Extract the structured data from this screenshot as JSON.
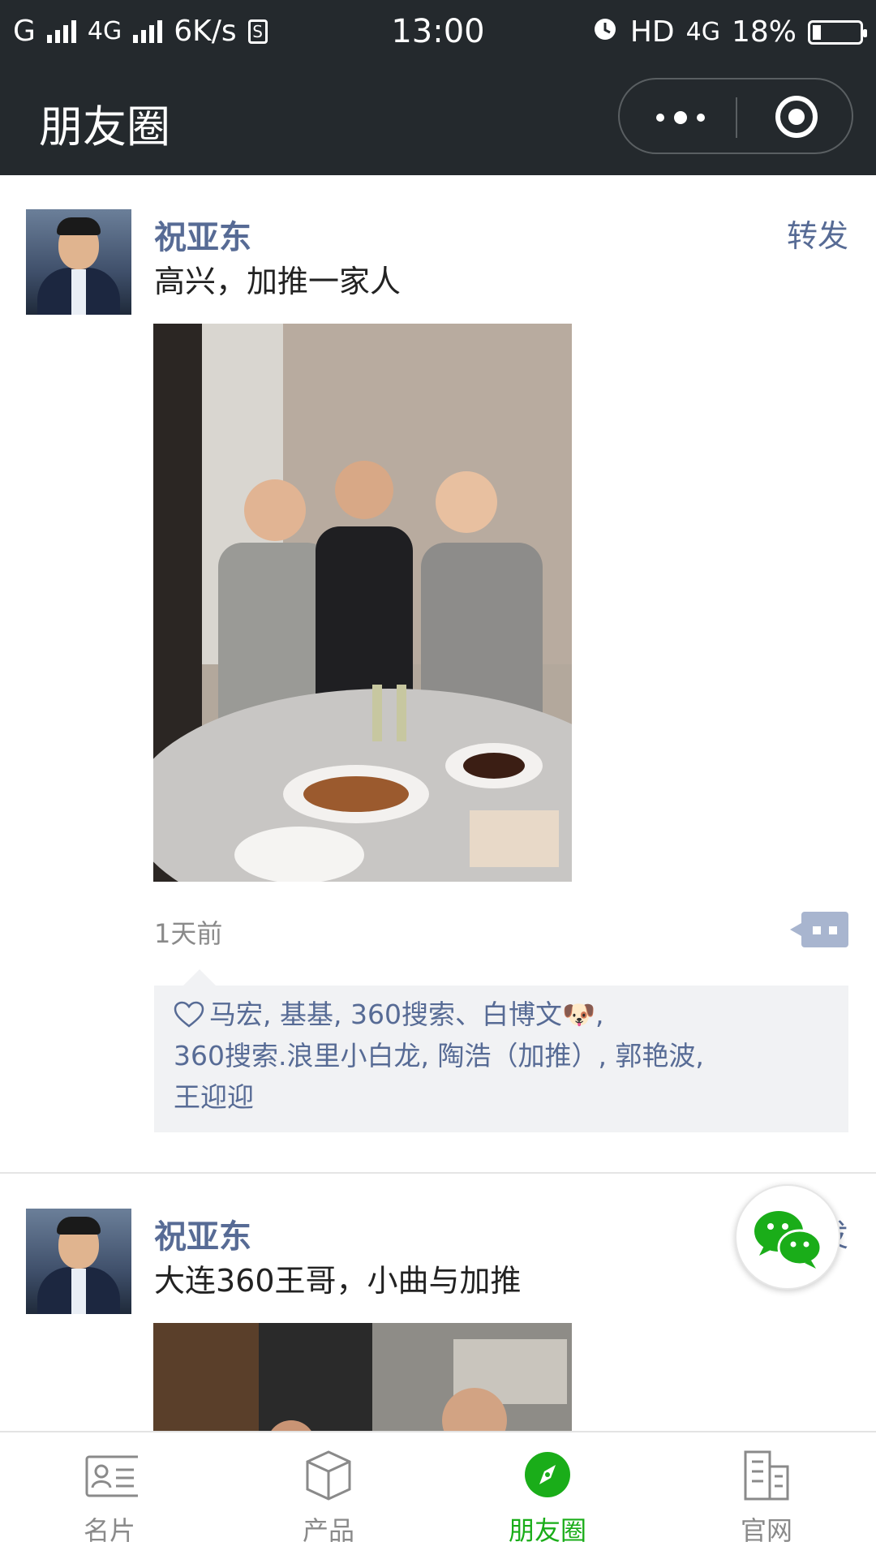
{
  "status_bar": {
    "carrier1": "G",
    "carrier2": "4G",
    "speed": "6K/s",
    "time": "13:00",
    "hd": "HD",
    "network": "4G",
    "battery": "18%"
  },
  "nav": {
    "title": "朋友圈"
  },
  "posts": [
    {
      "author": "祝亚东",
      "forward_label": "转发",
      "text": "高兴，加推一家人",
      "time": "1天前",
      "likes_line1": "马宏, 基基, 360搜索、白博文🐶,",
      "likes_line2": "360搜索.浪里小白龙, 陶浩（加推）, 郭艳波,",
      "likes_line3": "王迎迎"
    },
    {
      "author": "祝亚东",
      "forward_label": "转发",
      "text": "大连360王哥，小曲与加推"
    }
  ],
  "tabbar": {
    "items": [
      {
        "label": "名片",
        "icon": "card-icon"
      },
      {
        "label": "产品",
        "icon": "box-icon"
      },
      {
        "label": "朋友圈",
        "icon": "compass-icon",
        "active": true
      },
      {
        "label": "官网",
        "icon": "building-icon"
      }
    ]
  },
  "colors": {
    "header_bg": "#24292d",
    "link_blue": "#576b95",
    "active_green": "#1aad19"
  }
}
